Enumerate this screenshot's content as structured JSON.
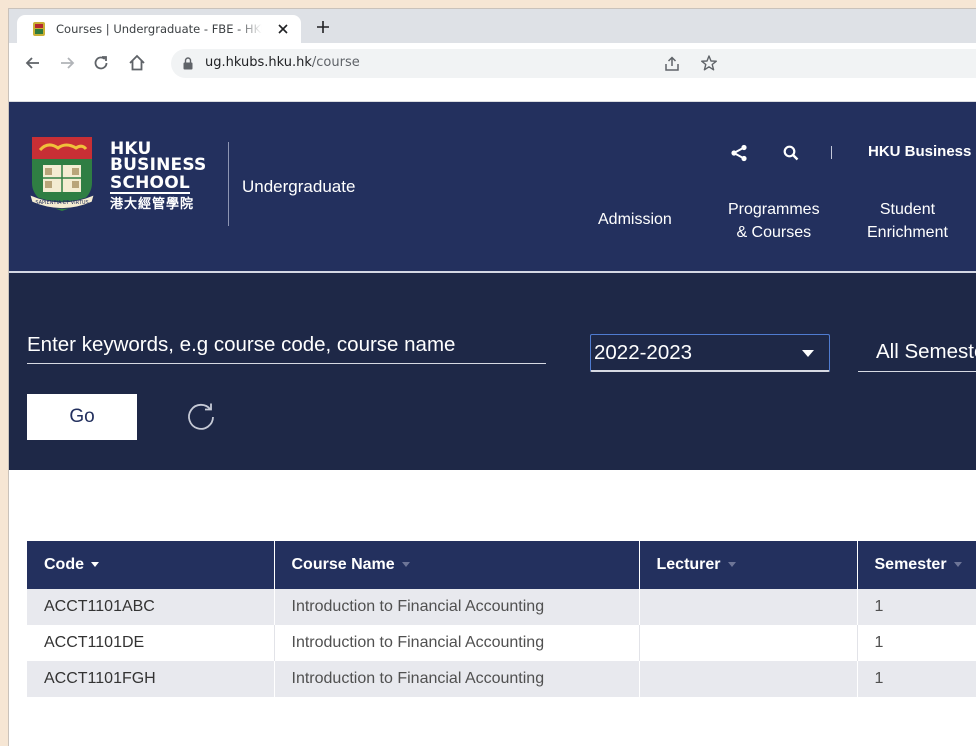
{
  "browser": {
    "tab_title": "Courses | Undergraduate - FBE - HKU",
    "url_host": "ug.hkubs.hku.hk",
    "url_path": "/course"
  },
  "header": {
    "brand_lines": [
      "HKU",
      "BUSINESS",
      "SCHOOL"
    ],
    "brand_chinese": "港大經管學院",
    "crest_motto": "SAPIENTIA ET VIRTUS",
    "subtitle": "Undergraduate",
    "utility_link": "HKU Business School",
    "nav": [
      {
        "line1": "Admission",
        "line2": ""
      },
      {
        "line1": "Programmes",
        "line2": "& Courses"
      },
      {
        "line1": "Student",
        "line2": "Enrichment"
      }
    ]
  },
  "search": {
    "keyword_placeholder": "Enter keywords, e.g course code, course name",
    "year_selected": "2022-2023",
    "semester_selected": "All Semesters",
    "go_label": "Go"
  },
  "table": {
    "columns": [
      "Code",
      "Course Name",
      "Lecturer",
      "Semester"
    ],
    "sorted_column": "Code",
    "rows": [
      {
        "code": "ACCT1101ABC",
        "name": "Introduction to Financial Accounting",
        "lecturer": "",
        "semester": "1"
      },
      {
        "code": "ACCT1101DE",
        "name": "Introduction to Financial Accounting",
        "lecturer": "",
        "semester": "1"
      },
      {
        "code": "ACCT1101FGH",
        "name": "Introduction to Financial Accounting",
        "lecturer": "",
        "semester": "1"
      }
    ]
  },
  "colors": {
    "header_navy": "#23305e",
    "search_panel": "#1e2847",
    "row_stripe": "#e8e9ee",
    "select_focus": "#4f7bd0"
  }
}
